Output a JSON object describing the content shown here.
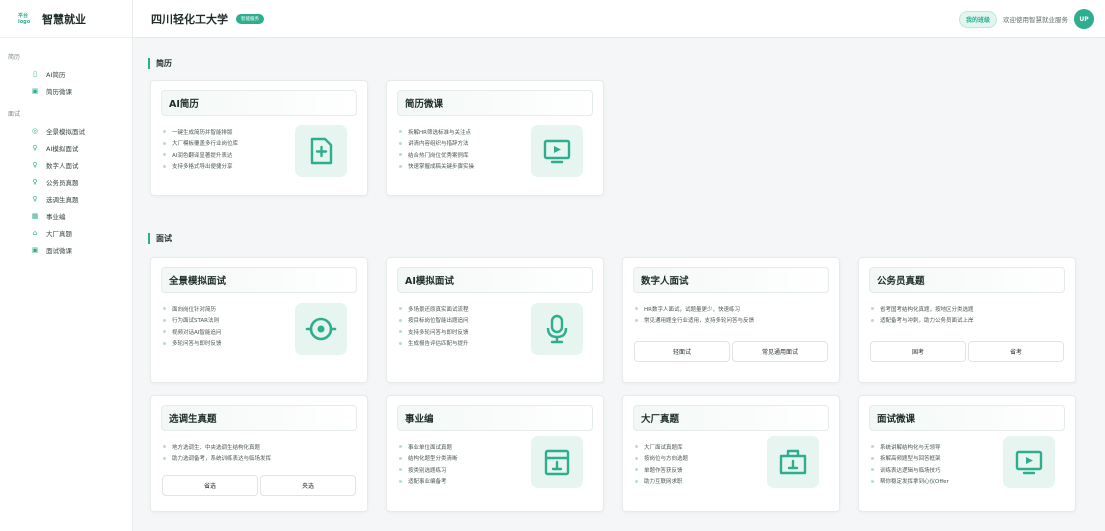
{
  "brand": {
    "logo_text": "平台logo",
    "name": "智慧就业"
  },
  "header": {
    "university": "四川轻化工大学",
    "badge": "智能服务",
    "my_class": "我的班级",
    "welcome": "欢迎使用智慧就业服务",
    "avatar": "UP"
  },
  "sidebar": {
    "group_resume": "简历",
    "resume_items": [
      {
        "label": "AI简历",
        "icon": "resume-doc-icon"
      },
      {
        "label": "简历微课",
        "icon": "video-icon"
      }
    ],
    "group_interview": "面试",
    "interview_items": [
      {
        "label": "全景模拟面试",
        "icon": "target-icon"
      },
      {
        "label": "AI模拟面试",
        "icon": "mic-icon"
      },
      {
        "label": "数字人面试",
        "icon": "mic-icon"
      },
      {
        "label": "公务员真题",
        "icon": "mic-icon"
      },
      {
        "label": "选调生真题",
        "icon": "mic-icon"
      },
      {
        "label": "事业编",
        "icon": "building-icon"
      },
      {
        "label": "大厂真题",
        "icon": "office-icon"
      },
      {
        "label": "面试微课",
        "icon": "video-icon"
      }
    ]
  },
  "sections": {
    "resume": "简历",
    "interview": "面试"
  },
  "cards": {
    "ai_resume": {
      "title": "AI简历",
      "bullets": [
        "一键生成简历并智能排版",
        "大厂模板覆盖多行业岗位库",
        "AI润色翻译显著提升表达",
        "支持多格式导出便捷分享"
      ]
    },
    "resume_course": {
      "title": "简历微课",
      "bullets": [
        "拆解HR筛选标准与关注点",
        "讲清内容组织与措辞方法",
        "结合热门岗位优秀案例库",
        "快速掌握成稿关键步骤实操"
      ]
    },
    "panorama": {
      "title": "全景模拟面试",
      "bullets": [
        "面向岗位针对简历",
        "行为面试STAR法则",
        "视频对话AI智能追问",
        "多轮问答与即时反馈"
      ]
    },
    "ai_interview": {
      "title": "AI模拟面试",
      "bullets": [
        "多场景还原真实面试流程",
        "按目标岗位智能出题追问",
        "支持多轮问答与即时反馈",
        "生成报告评估匹配与提升"
      ]
    },
    "digital": {
      "title": "数字人面试",
      "bullets": [
        "HR数字人面试，试题量更少，快速练习",
        "常见通用题全行业适用，支持多轮问答与反馈"
      ],
      "btn1": "轻面试",
      "btn2": "常见通用面试"
    },
    "civil": {
      "title": "公务员真题",
      "bullets": [
        "省考国考结构化真题，按地区分类选题",
        "适配备考与冲刺，助力公务员面试上岸"
      ],
      "btn1": "国考",
      "btn2": "省考"
    },
    "selected": {
      "title": "选调生真题",
      "bullets": [
        "地方选调生、中央选调生结构化真题",
        "助力选调备考，系统训练表达与临场发挥"
      ],
      "btn1": "省选",
      "btn2": "央选"
    },
    "public": {
      "title": "事业编",
      "bullets": [
        "事业单位面试真题",
        "结构化题型分类清晰",
        "按类别选题练习",
        "适配事业编备考"
      ]
    },
    "bigco": {
      "title": "大厂真题",
      "bullets": [
        "大厂面试真题库",
        "按岗位与方向选题",
        "单题作答获反馈",
        "助力互联网求职"
      ]
    },
    "course": {
      "title": "面试微课",
      "bullets": [
        "系统讲解结构化与无领导",
        "拆解高频题型与回答框架",
        "训练表达逻辑与临场技巧",
        "帮你稳定发挥拿到心仪Offer"
      ]
    }
  },
  "colors": {
    "accent": "#2fae8f",
    "icon_bg": "#e7f5f0"
  }
}
